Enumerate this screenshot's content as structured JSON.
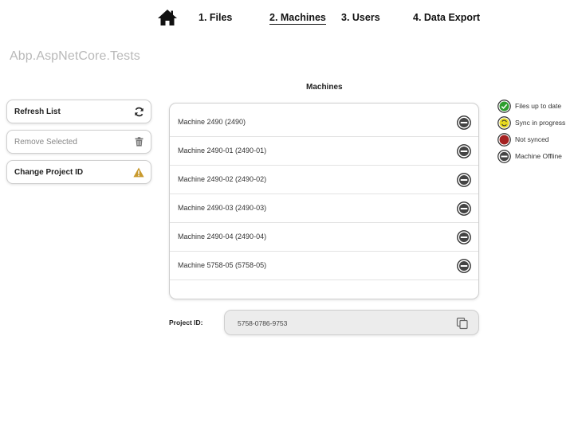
{
  "nav": {
    "home_icon": "home-icon",
    "tabs": [
      {
        "label": "1. Files",
        "active": false
      },
      {
        "label": "2. Machines",
        "active": true
      },
      {
        "label": "3. Users",
        "active": false
      },
      {
        "label": "4. Data Export",
        "active": false
      }
    ]
  },
  "app_title": "Abp.AspNetCore.Tests",
  "sidebar": {
    "refresh_label": "Refresh List",
    "refresh_icon": "refresh-icon",
    "remove_label": "Remove Selected",
    "remove_icon": "trash-icon",
    "remove_enabled": false,
    "change_label": "Change Project ID",
    "change_icon": "warning-icon"
  },
  "machines": {
    "title": "Machines",
    "rows": [
      {
        "name": "Machine 2490 (2490)",
        "status": "offline"
      },
      {
        "name": "Machine 2490-01 (2490-01)",
        "status": "offline"
      },
      {
        "name": "Machine 2490-02 (2490-02)",
        "status": "offline"
      },
      {
        "name": "Machine 2490-03 (2490-03)",
        "status": "offline"
      },
      {
        "name": "Machine 2490-04 (2490-04)",
        "status": "offline"
      },
      {
        "name": "Machine 5758-05 (5758-05)",
        "status": "offline"
      }
    ]
  },
  "legend": [
    {
      "label": "Files up to date",
      "status": "up-to-date",
      "color": "#2e9e2e"
    },
    {
      "label": "Sync in progress",
      "status": "syncing",
      "color": "#e6d81e"
    },
    {
      "label": "Not synced",
      "status": "not-synced",
      "color": "#a52222"
    },
    {
      "label": "Machine Offline",
      "status": "offline",
      "color": "#555555"
    }
  ],
  "project": {
    "label": "Project ID:",
    "value": "5758-0786-9753",
    "copy_icon": "copy-icon"
  }
}
